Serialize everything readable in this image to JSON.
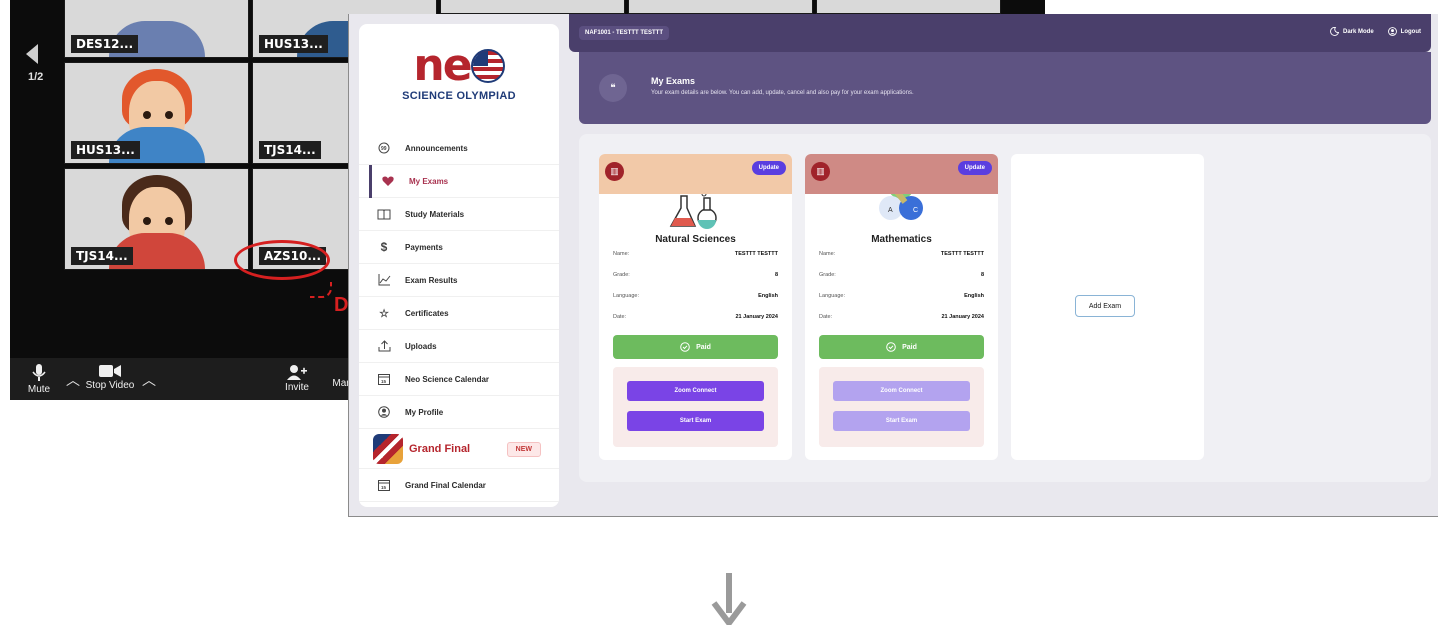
{
  "zoom": {
    "page_indicator": "1/2",
    "tiles": [
      {
        "tag": "DES12..."
      },
      {
        "tag": "HUS13..."
      },
      {
        "tag": "HUS13..."
      },
      {
        "tag": "TJS14..."
      },
      {
        "tag": "TJS14..."
      },
      {
        "tag": "AZS10..."
      }
    ],
    "toolbar": {
      "mute": "Mute",
      "stop_video": "Stop Video",
      "invite": "Invite",
      "more_cut": "Mar"
    },
    "annotation_letter": "D"
  },
  "portal": {
    "logo": {
      "word": "ne",
      "subtitle": "SCIENCE OLYMPIAD"
    },
    "sidebar": {
      "items": [
        {
          "label": "Announcements",
          "icon": "chat-icon"
        },
        {
          "label": "My Exams",
          "icon": "heart-icon"
        },
        {
          "label": "Study Materials",
          "icon": "book-icon"
        },
        {
          "label": "Payments",
          "icon": "dollar-icon"
        },
        {
          "label": "Exam Results",
          "icon": "chart-icon"
        },
        {
          "label": "Certificates",
          "icon": "star-icon"
        },
        {
          "label": "Uploads",
          "icon": "upload-icon"
        },
        {
          "label": "Neo Science Calendar",
          "icon": "calendar-icon"
        },
        {
          "label": "My Profile",
          "icon": "user-icon"
        },
        {
          "label": "Grand Final",
          "icon": "flag-icon",
          "badge": "NEW"
        },
        {
          "label": "Grand Final Calendar",
          "icon": "calendar-icon"
        }
      ]
    },
    "topbar": {
      "user": "NAF1001 - TESTTT TESTTT",
      "dark_mode": "Dark Mode",
      "logout": "Logout"
    },
    "banner": {
      "title": "My Exams",
      "subtitle": "Your exam details are below. You can add, update, cancel and also pay for your exam applications."
    },
    "exams": [
      {
        "subject": "Natural Sciences",
        "update": "Update",
        "header_color": "#f2c9a8",
        "fields": [
          {
            "key": "Name:",
            "value": "TESTTT TESTTT"
          },
          {
            "key": "Grade:",
            "value": "8"
          },
          {
            "key": "Language:",
            "value": "English"
          },
          {
            "key": "Date:",
            "value": "21 January 2024"
          }
        ],
        "status": "Paid",
        "zoom_connect": "Zoom Connect",
        "start_exam": "Start Exam"
      },
      {
        "subject": "Mathematics",
        "update": "Update",
        "header_color": "#cf8a85",
        "fields": [
          {
            "key": "Name:",
            "value": "TESTTT TESTTT"
          },
          {
            "key": "Grade:",
            "value": "8"
          },
          {
            "key": "Language:",
            "value": "English"
          },
          {
            "key": "Date:",
            "value": "21 January 2024"
          }
        ],
        "status": "Paid",
        "zoom_connect": "Zoom Connect",
        "start_exam": "Start Exam"
      }
    ],
    "add_exam": "Add Exam",
    "colors": {
      "brand_purple": "#4a3f6b",
      "paid_green": "#6dbb5e",
      "button_purple": "#7a44e6",
      "button_purple_disabled": "#b3a3ef",
      "logo_red": "#b5252d"
    }
  }
}
